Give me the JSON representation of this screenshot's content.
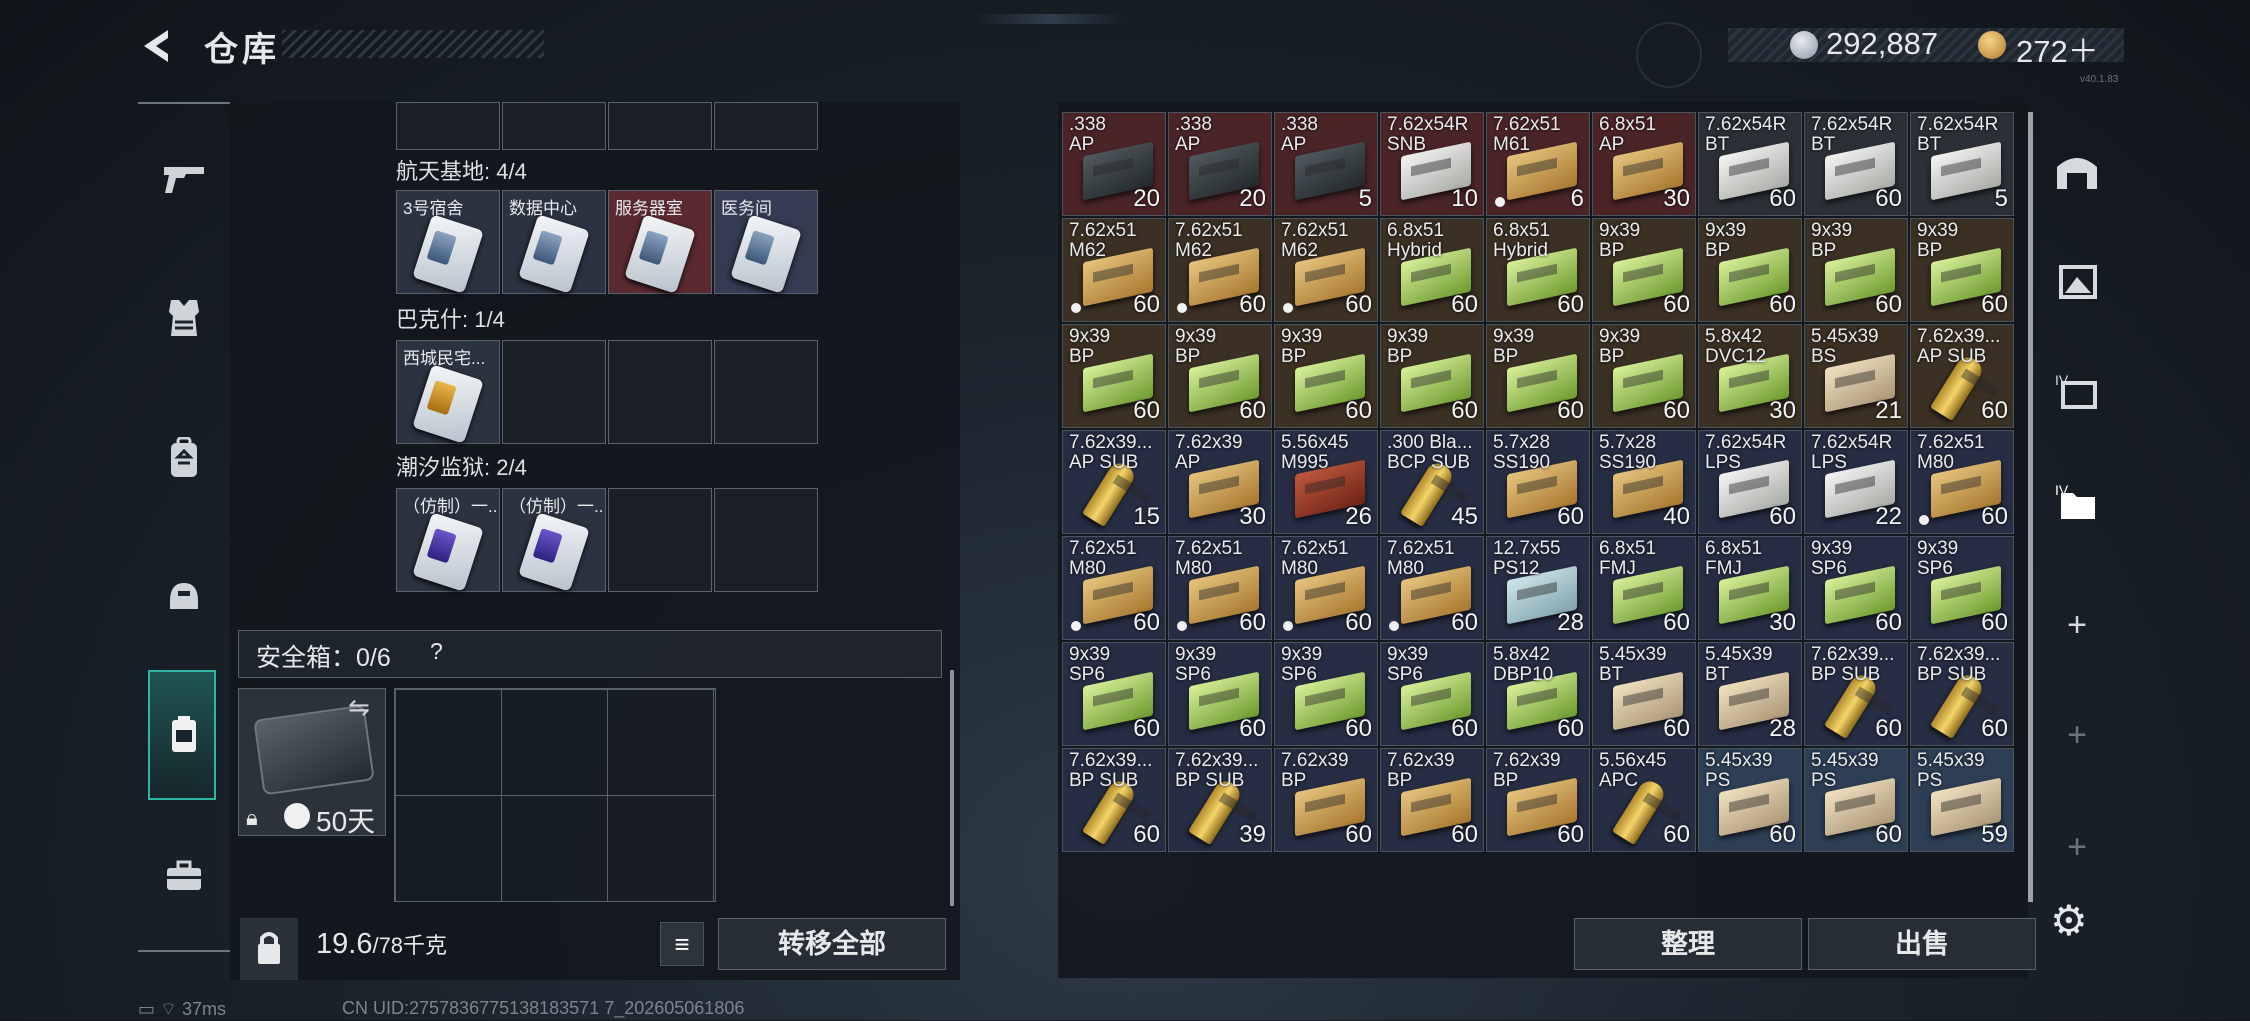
{
  "header": {
    "title": "仓库",
    "money": "292,887",
    "coins": "272＋",
    "version": "v40.1.83"
  },
  "nav_items": [
    "weapon",
    "armor",
    "backpack",
    "helmet",
    "safebox",
    "toolkit"
  ],
  "keycard_groups": [
    {
      "label": "航天基地: 4/4",
      "cards": [
        {
          "name": "3号宿舍",
          "tint": "card",
          "chip": ""
        },
        {
          "name": "数据中心",
          "tint": "card",
          "chip": ""
        },
        {
          "name": "服务器室",
          "tint": "red",
          "chip": ""
        },
        {
          "name": "医务间",
          "tint": "blue",
          "chip": ""
        }
      ]
    },
    {
      "label": "巴克什: 1/4",
      "cards": [
        {
          "name": "西城民宅...",
          "tint": "card",
          "chip": "gold"
        },
        {
          "name": "",
          "tint": "empty",
          "chip": "none"
        },
        {
          "name": "",
          "tint": "empty",
          "chip": "none"
        },
        {
          "name": "",
          "tint": "empty",
          "chip": "none"
        }
      ]
    },
    {
      "label": "潮汐监狱: 2/4",
      "cards": [
        {
          "name": "（仿制）一...",
          "tint": "card",
          "chip": "purple"
        },
        {
          "name": "（仿制）一...",
          "tint": "card",
          "chip": "purple"
        },
        {
          "name": "",
          "tint": "empty",
          "chip": "none"
        },
        {
          "name": "",
          "tint": "empty",
          "chip": "none"
        }
      ]
    }
  ],
  "safebox": {
    "label": "安全箱：0/6",
    "help": "?",
    "days": "50天"
  },
  "weight": {
    "current": "19.6",
    "max": "/78千克"
  },
  "buttons": {
    "transfer_all": "转移全部",
    "sort": "整理",
    "sell": "出售",
    "list": "≡"
  },
  "ammo_grid": [
    [
      {
        "c": ".338",
        "t": "AP",
        "n": "20",
        "bg": "red",
        "box": "dark"
      },
      {
        "c": ".338",
        "t": "AP",
        "n": "20",
        "bg": "red",
        "box": "dark"
      },
      {
        "c": ".338",
        "t": "AP",
        "n": "5",
        "bg": "red",
        "box": "dark"
      },
      {
        "c": "7.62x54R",
        "t": "SNB",
        "n": "10",
        "bg": "red",
        "box": "white"
      },
      {
        "c": "7.62x51",
        "t": "M61",
        "n": "6",
        "bg": "red",
        "box": "tan",
        "dot": true
      },
      {
        "c": "6.8x51",
        "t": "AP",
        "n": "30",
        "bg": "red",
        "box": "tan"
      },
      {
        "c": "7.62x54R",
        "t": "BT",
        "n": "60",
        "bg": "gray",
        "box": "white"
      },
      {
        "c": "7.62x54R",
        "t": "BT",
        "n": "60",
        "bg": "gray",
        "box": "white"
      },
      {
        "c": "7.62x54R",
        "t": "BT",
        "n": "5",
        "bg": "gray",
        "box": "white"
      }
    ],
    [
      {
        "c": "7.62x51",
        "t": "M62",
        "n": "60",
        "bg": "brown",
        "box": "tan",
        "dot": true
      },
      {
        "c": "7.62x51",
        "t": "M62",
        "n": "60",
        "bg": "brown",
        "box": "tan",
        "dot": true
      },
      {
        "c": "7.62x51",
        "t": "M62",
        "n": "60",
        "bg": "brown",
        "box": "tan",
        "dot": true
      },
      {
        "c": "6.8x51",
        "t": "Hybrid",
        "n": "60",
        "bg": "brown",
        "box": "green"
      },
      {
        "c": "6.8x51",
        "t": "Hybrid",
        "n": "60",
        "bg": "brown",
        "box": "green"
      },
      {
        "c": "9x39",
        "t": "BP",
        "n": "60",
        "bg": "brown",
        "box": "green"
      },
      {
        "c": "9x39",
        "t": "BP",
        "n": "60",
        "bg": "brown",
        "box": "green"
      },
      {
        "c": "9x39",
        "t": "BP",
        "n": "60",
        "bg": "brown",
        "box": "green"
      },
      {
        "c": "9x39",
        "t": "BP",
        "n": "60",
        "bg": "brown",
        "box": "green"
      }
    ],
    [
      {
        "c": "9x39",
        "t": "BP",
        "n": "60",
        "bg": "brown",
        "box": "green"
      },
      {
        "c": "9x39",
        "t": "BP",
        "n": "60",
        "bg": "brown",
        "box": "green"
      },
      {
        "c": "9x39",
        "t": "BP",
        "n": "60",
        "bg": "brown",
        "box": "green"
      },
      {
        "c": "9x39",
        "t": "BP",
        "n": "60",
        "bg": "brown",
        "box": "green"
      },
      {
        "c": "9x39",
        "t": "BP",
        "n": "60",
        "bg": "brown",
        "box": "green"
      },
      {
        "c": "9x39",
        "t": "BP",
        "n": "60",
        "bg": "brown",
        "box": "green"
      },
      {
        "c": "5.8x42",
        "t": "DVC12",
        "n": "30",
        "bg": "brown",
        "box": "green"
      },
      {
        "c": "5.45x39",
        "t": "BS",
        "n": "21",
        "bg": "brown",
        "box": "cream"
      },
      {
        "c": "7.62x39...",
        "t": "AP SUB",
        "n": "60",
        "bg": "brown",
        "box": "bullet"
      }
    ],
    [
      {
        "c": "7.62x39...",
        "t": "AP SUB",
        "n": "15",
        "bg": "navy",
        "box": "bullet"
      },
      {
        "c": "7.62x39",
        "t": "AP",
        "n": "30",
        "bg": "navy",
        "box": "tan"
      },
      {
        "c": "5.56x45",
        "t": "M995",
        "n": "26",
        "bg": "navy",
        "box": "redb"
      },
      {
        "c": ".300 Bla...",
        "t": "BCP SUB",
        "n": "45",
        "bg": "navy",
        "box": "bullet"
      },
      {
        "c": "5.7x28",
        "t": "SS190",
        "n": "60",
        "bg": "navy",
        "box": "tan"
      },
      {
        "c": "5.7x28",
        "t": "SS190",
        "n": "40",
        "bg": "navy",
        "box": "tan"
      },
      {
        "c": "7.62x54R",
        "t": "LPS",
        "n": "60",
        "bg": "navy",
        "box": "white"
      },
      {
        "c": "7.62x54R",
        "t": "LPS",
        "n": "22",
        "bg": "navy",
        "box": "white"
      },
      {
        "c": "7.62x51",
        "t": "M80",
        "n": "60",
        "bg": "navy",
        "box": "tan",
        "dot": true
      }
    ],
    [
      {
        "c": "7.62x51",
        "t": "M80",
        "n": "60",
        "bg": "navy",
        "box": "tan",
        "dot": true
      },
      {
        "c": "7.62x51",
        "t": "M80",
        "n": "60",
        "bg": "navy",
        "box": "tan",
        "dot": true
      },
      {
        "c": "7.62x51",
        "t": "M80",
        "n": "60",
        "bg": "navy",
        "box": "tan",
        "dot": true
      },
      {
        "c": "7.62x51",
        "t": "M80",
        "n": "60",
        "bg": "navy",
        "box": "tan",
        "dot": true
      },
      {
        "c": "12.7x55",
        "t": "PS12",
        "n": "28",
        "bg": "navy",
        "box": "teal"
      },
      {
        "c": "6.8x51",
        "t": "FMJ",
        "n": "60",
        "bg": "navy",
        "box": "green"
      },
      {
        "c": "6.8x51",
        "t": "FMJ",
        "n": "30",
        "bg": "navy",
        "box": "green"
      },
      {
        "c": "9x39",
        "t": "SP6",
        "n": "60",
        "bg": "navy",
        "box": "green"
      },
      {
        "c": "9x39",
        "t": "SP6",
        "n": "60",
        "bg": "navy",
        "box": "green"
      }
    ],
    [
      {
        "c": "9x39",
        "t": "SP6",
        "n": "60",
        "bg": "navy",
        "box": "green"
      },
      {
        "c": "9x39",
        "t": "SP6",
        "n": "60",
        "bg": "navy",
        "box": "green"
      },
      {
        "c": "9x39",
        "t": "SP6",
        "n": "60",
        "bg": "navy",
        "box": "green"
      },
      {
        "c": "9x39",
        "t": "SP6",
        "n": "60",
        "bg": "navy",
        "box": "green"
      },
      {
        "c": "5.8x42",
        "t": "DBP10",
        "n": "60",
        "bg": "navy",
        "box": "green"
      },
      {
        "c": "5.45x39",
        "t": "BT",
        "n": "60",
        "bg": "navy",
        "box": "cream"
      },
      {
        "c": "5.45x39",
        "t": "BT",
        "n": "28",
        "bg": "navy",
        "box": "cream"
      },
      {
        "c": "7.62x39...",
        "t": "BP SUB",
        "n": "60",
        "bg": "navy",
        "box": "bullet"
      },
      {
        "c": "7.62x39...",
        "t": "BP SUB",
        "n": "60",
        "bg": "navy",
        "box": "bullet"
      }
    ],
    [
      {
        "c": "7.62x39...",
        "t": "BP SUB",
        "n": "60",
        "bg": "navy",
        "box": "bullet"
      },
      {
        "c": "7.62x39...",
        "t": "BP SUB",
        "n": "39",
        "bg": "navy",
        "box": "bullet"
      },
      {
        "c": "7.62x39",
        "t": "BP",
        "n": "60",
        "bg": "navy",
        "box": "tan"
      },
      {
        "c": "7.62x39",
        "t": "BP",
        "n": "60",
        "bg": "navy",
        "box": "tan"
      },
      {
        "c": "7.62x39",
        "t": "BP",
        "n": "60",
        "bg": "navy",
        "box": "tan"
      },
      {
        "c": "5.56x45",
        "t": "APC",
        "n": "60",
        "bg": "navy",
        "box": "bullet"
      },
      {
        "c": "5.45x39",
        "t": "PS",
        "n": "60",
        "bg": "blue",
        "box": "cream"
      },
      {
        "c": "5.45x39",
        "t": "PS",
        "n": "60",
        "bg": "blue",
        "box": "cream"
      },
      {
        "c": "5.45x39",
        "t": "PS",
        "n": "59",
        "bg": "blue",
        "box": "cream"
      }
    ]
  ],
  "status": {
    "ping": "37ms",
    "uid": "CN UID:2757836775138183571 7_202605061806"
  }
}
